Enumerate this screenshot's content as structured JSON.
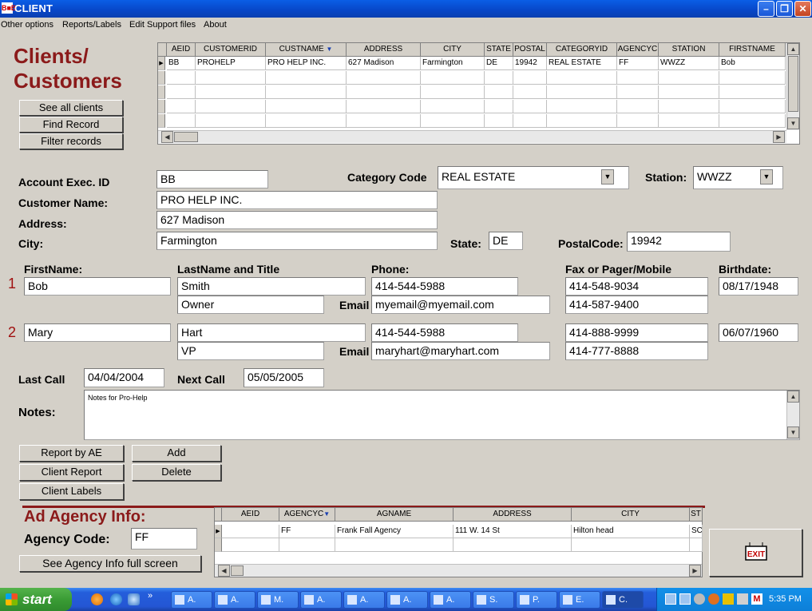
{
  "window": {
    "title": "CLIENT",
    "icon_text": "B■B",
    "minimize": "–",
    "maximize": "❐",
    "close": "✕"
  },
  "menu": [
    "Other options",
    "Reports/Labels",
    "Edit Support files",
    "About"
  ],
  "heading": {
    "line1": "Clients/",
    "line2": "Customers"
  },
  "side_buttons": {
    "see_all": "See all clients",
    "find": "Find Record",
    "filter": "Filter records"
  },
  "client_grid": {
    "columns": [
      "AEID",
      "CUSTOMERID",
      "CUSTNAME",
      "ADDRESS",
      "CITY",
      "STATE",
      "POSTAL",
      "CATEGORYID",
      "AGENCYC",
      "STATION",
      "FIRSTNAME"
    ],
    "sort_indicator": "▼",
    "row": [
      "BB",
      "PROHELP",
      "PRO HELP INC.",
      "627 Madison",
      "Farmington",
      "DE",
      "19942",
      "REAL ESTATE",
      "FF",
      "WWZZ",
      "Bob"
    ]
  },
  "labels": {
    "ae_id": "Account Exec. ID",
    "customer_name": "Customer Name:",
    "address": "Address:",
    "city": "City:",
    "category": "Category Code",
    "station": "Station:",
    "state": "State:",
    "postal": "PostalCode:",
    "first_name": "FirstName:",
    "last_name": "LastName and Title",
    "phone": "Phone:",
    "fax": "Fax or Pager/Mobile",
    "birthdate": "Birthdate:",
    "email": "Email",
    "last_call": "Last Call",
    "next_call": "Next Call",
    "notes": "Notes:"
  },
  "record": {
    "ae_id": "BB",
    "customer_name": "PRO HELP INC.",
    "address": "627 Madison",
    "city": "Farmington",
    "category": "REAL ESTATE",
    "station": "WWZZ",
    "state": "DE",
    "postal": "19942",
    "last_call": "04/04/2004",
    "next_call": "05/05/2005",
    "notes": "Notes for Pro-Help"
  },
  "contacts": [
    {
      "num": "1",
      "first": "Bob",
      "last": "Smith",
      "title": "Owner",
      "phone": "414-544-5988",
      "email": "myemail@myemail.com",
      "fax": "414-548-9034",
      "mobile": "414-587-9400",
      "birthdate": "08/17/1948"
    },
    {
      "num": "2",
      "first": "Mary",
      "last": "Hart",
      "title": "VP",
      "phone": "414-544-5988",
      "email": "maryhart@maryhart.com",
      "fax": "414-888-9999",
      "mobile": "414-777-8888",
      "birthdate": "06/07/1960"
    }
  ],
  "action_buttons": {
    "report_by_ae": "Report by AE",
    "add": "Add",
    "client_report": "Client Report",
    "delete": "Delete",
    "client_labels": "Client Labels"
  },
  "agency": {
    "heading": "Ad Agency Info:",
    "code_label": "Agency Code:",
    "code": "FF",
    "full_screen_button": "See Agency Info full screen",
    "grid_columns": [
      "AEID",
      "AGENCYC",
      "AGNAME",
      "ADDRESS",
      "CITY",
      "ST"
    ],
    "grid_row": [
      "",
      "FF",
      "Frank Fall Agency",
      "111 W. 14 St",
      "Hilton head",
      "SC"
    ]
  },
  "exit_label": "EXIT",
  "taskbar": {
    "start": "start",
    "buttons": [
      "A.",
      "A.",
      "M.",
      "A.",
      "A.",
      "A.",
      "A.",
      "S.",
      "P.",
      "E.",
      "C."
    ],
    "clock": "5:35 PM"
  }
}
